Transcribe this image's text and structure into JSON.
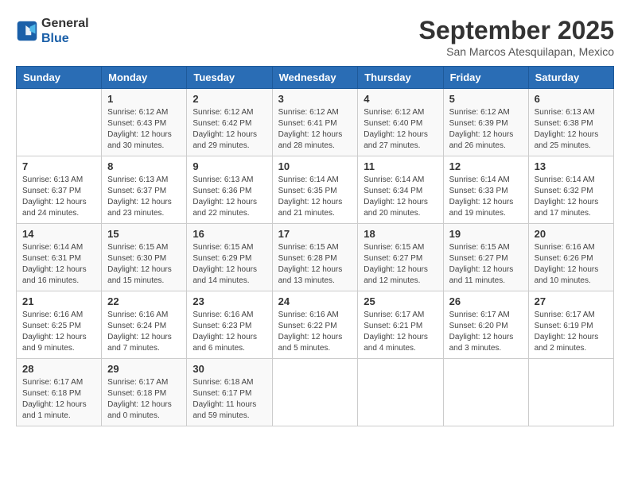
{
  "header": {
    "logo_general": "General",
    "logo_blue": "Blue",
    "month_title": "September 2025",
    "location": "San Marcos Atesquilapan, Mexico"
  },
  "days_of_week": [
    "Sunday",
    "Monday",
    "Tuesday",
    "Wednesday",
    "Thursday",
    "Friday",
    "Saturday"
  ],
  "weeks": [
    [
      {
        "day": "",
        "info": ""
      },
      {
        "day": "1",
        "info": "Sunrise: 6:12 AM\nSunset: 6:43 PM\nDaylight: 12 hours\nand 30 minutes."
      },
      {
        "day": "2",
        "info": "Sunrise: 6:12 AM\nSunset: 6:42 PM\nDaylight: 12 hours\nand 29 minutes."
      },
      {
        "day": "3",
        "info": "Sunrise: 6:12 AM\nSunset: 6:41 PM\nDaylight: 12 hours\nand 28 minutes."
      },
      {
        "day": "4",
        "info": "Sunrise: 6:12 AM\nSunset: 6:40 PM\nDaylight: 12 hours\nand 27 minutes."
      },
      {
        "day": "5",
        "info": "Sunrise: 6:12 AM\nSunset: 6:39 PM\nDaylight: 12 hours\nand 26 minutes."
      },
      {
        "day": "6",
        "info": "Sunrise: 6:13 AM\nSunset: 6:38 PM\nDaylight: 12 hours\nand 25 minutes."
      }
    ],
    [
      {
        "day": "7",
        "info": "Sunrise: 6:13 AM\nSunset: 6:37 PM\nDaylight: 12 hours\nand 24 minutes."
      },
      {
        "day": "8",
        "info": "Sunrise: 6:13 AM\nSunset: 6:37 PM\nDaylight: 12 hours\nand 23 minutes."
      },
      {
        "day": "9",
        "info": "Sunrise: 6:13 AM\nSunset: 6:36 PM\nDaylight: 12 hours\nand 22 minutes."
      },
      {
        "day": "10",
        "info": "Sunrise: 6:14 AM\nSunset: 6:35 PM\nDaylight: 12 hours\nand 21 minutes."
      },
      {
        "day": "11",
        "info": "Sunrise: 6:14 AM\nSunset: 6:34 PM\nDaylight: 12 hours\nand 20 minutes."
      },
      {
        "day": "12",
        "info": "Sunrise: 6:14 AM\nSunset: 6:33 PM\nDaylight: 12 hours\nand 19 minutes."
      },
      {
        "day": "13",
        "info": "Sunrise: 6:14 AM\nSunset: 6:32 PM\nDaylight: 12 hours\nand 17 minutes."
      }
    ],
    [
      {
        "day": "14",
        "info": "Sunrise: 6:14 AM\nSunset: 6:31 PM\nDaylight: 12 hours\nand 16 minutes."
      },
      {
        "day": "15",
        "info": "Sunrise: 6:15 AM\nSunset: 6:30 PM\nDaylight: 12 hours\nand 15 minutes."
      },
      {
        "day": "16",
        "info": "Sunrise: 6:15 AM\nSunset: 6:29 PM\nDaylight: 12 hours\nand 14 minutes."
      },
      {
        "day": "17",
        "info": "Sunrise: 6:15 AM\nSunset: 6:28 PM\nDaylight: 12 hours\nand 13 minutes."
      },
      {
        "day": "18",
        "info": "Sunrise: 6:15 AM\nSunset: 6:27 PM\nDaylight: 12 hours\nand 12 minutes."
      },
      {
        "day": "19",
        "info": "Sunrise: 6:15 AM\nSunset: 6:27 PM\nDaylight: 12 hours\nand 11 minutes."
      },
      {
        "day": "20",
        "info": "Sunrise: 6:16 AM\nSunset: 6:26 PM\nDaylight: 12 hours\nand 10 minutes."
      }
    ],
    [
      {
        "day": "21",
        "info": "Sunrise: 6:16 AM\nSunset: 6:25 PM\nDaylight: 12 hours\nand 9 minutes."
      },
      {
        "day": "22",
        "info": "Sunrise: 6:16 AM\nSunset: 6:24 PM\nDaylight: 12 hours\nand 7 minutes."
      },
      {
        "day": "23",
        "info": "Sunrise: 6:16 AM\nSunset: 6:23 PM\nDaylight: 12 hours\nand 6 minutes."
      },
      {
        "day": "24",
        "info": "Sunrise: 6:16 AM\nSunset: 6:22 PM\nDaylight: 12 hours\nand 5 minutes."
      },
      {
        "day": "25",
        "info": "Sunrise: 6:17 AM\nSunset: 6:21 PM\nDaylight: 12 hours\nand 4 minutes."
      },
      {
        "day": "26",
        "info": "Sunrise: 6:17 AM\nSunset: 6:20 PM\nDaylight: 12 hours\nand 3 minutes."
      },
      {
        "day": "27",
        "info": "Sunrise: 6:17 AM\nSunset: 6:19 PM\nDaylight: 12 hours\nand 2 minutes."
      }
    ],
    [
      {
        "day": "28",
        "info": "Sunrise: 6:17 AM\nSunset: 6:18 PM\nDaylight: 12 hours\nand 1 minute."
      },
      {
        "day": "29",
        "info": "Sunrise: 6:17 AM\nSunset: 6:18 PM\nDaylight: 12 hours\nand 0 minutes."
      },
      {
        "day": "30",
        "info": "Sunrise: 6:18 AM\nSunset: 6:17 PM\nDaylight: 11 hours\nand 59 minutes."
      },
      {
        "day": "",
        "info": ""
      },
      {
        "day": "",
        "info": ""
      },
      {
        "day": "",
        "info": ""
      },
      {
        "day": "",
        "info": ""
      }
    ]
  ]
}
